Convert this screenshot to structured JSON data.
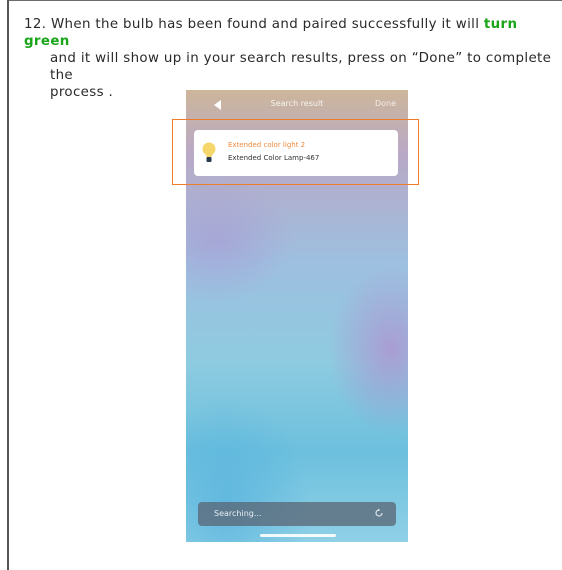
{
  "instruction": {
    "step": "12.",
    "line1_before": "When the bulb has been found and paired successfully it will ",
    "highlight": "turn green",
    "line2": "and it will show up in your search results, press on “Done” to complete the",
    "line3": "process ."
  },
  "phone": {
    "nav_title": "Search result",
    "nav_done": "Done",
    "result": {
      "name": "Extended color light 2",
      "model": "Extended Color Lamp-467"
    },
    "search_status": "Searching..."
  },
  "colors": {
    "highlight_text": "#1aa51a",
    "callout_border": "#f07c2a",
    "result_name": "#f08a3c"
  }
}
